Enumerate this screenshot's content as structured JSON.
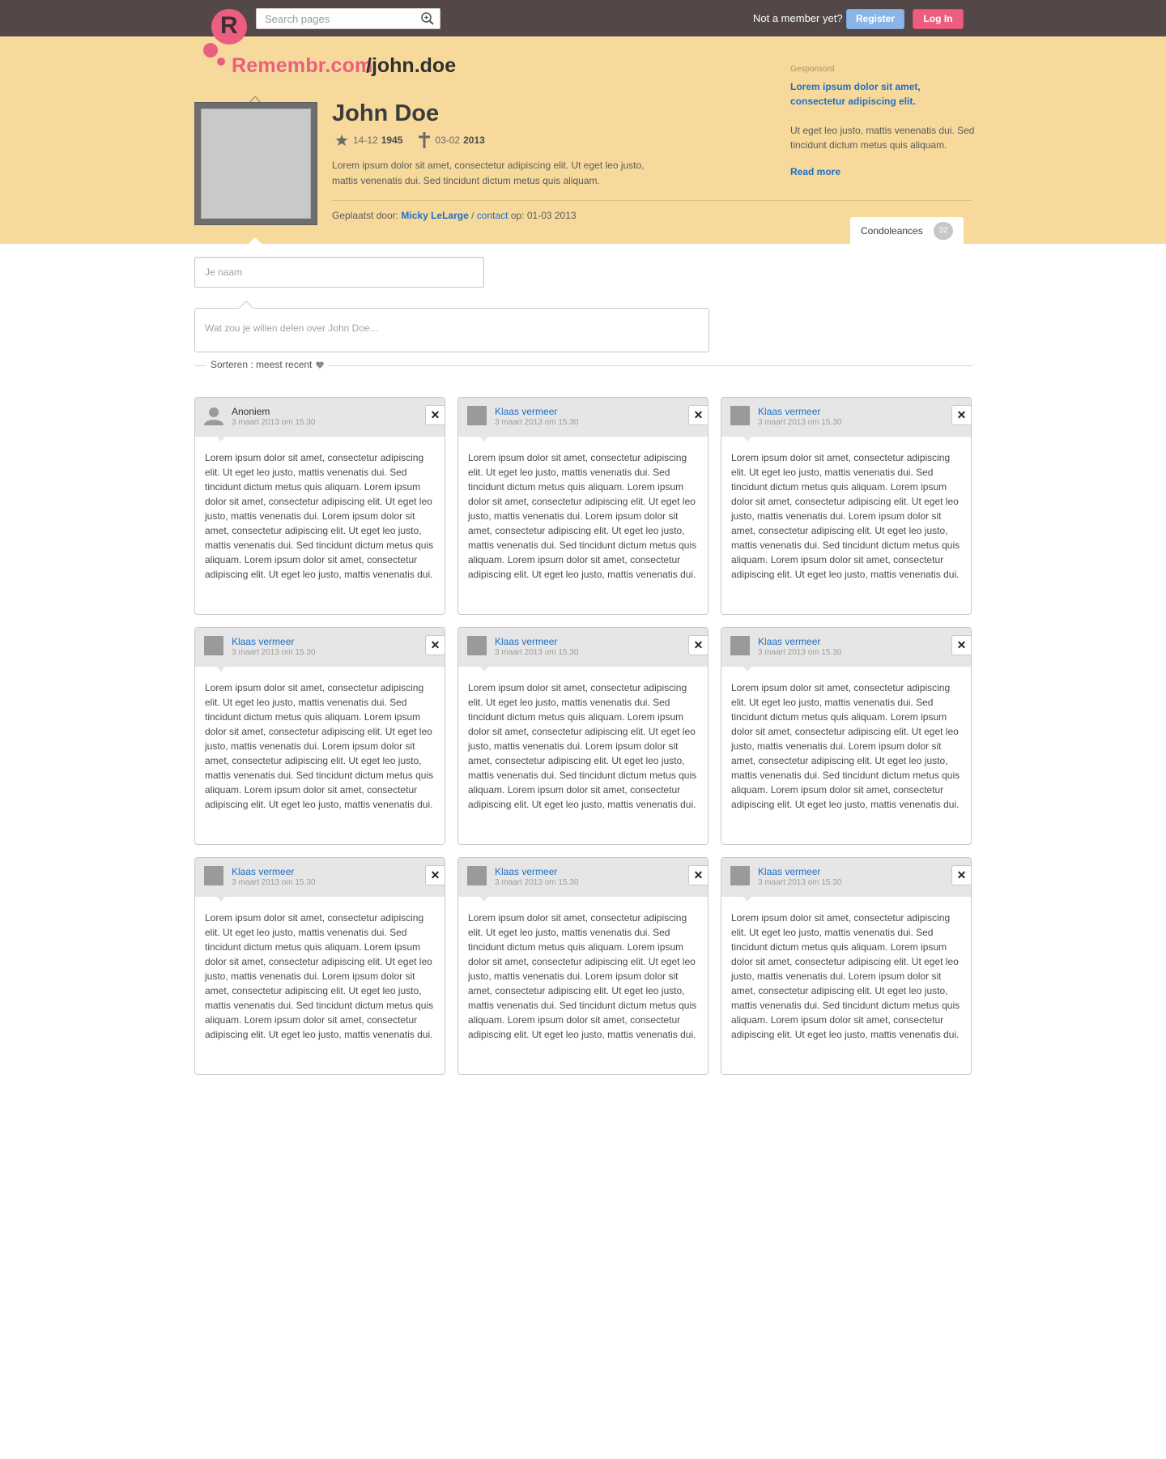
{
  "topbar": {
    "search_placeholder": "Search pages",
    "member_prompt": "Not a member yet?",
    "register_label": "Register",
    "login_label": "Log In",
    "colors": {
      "bar": "#534847",
      "register": "#8bb5e6",
      "login": "#ec5e7f"
    }
  },
  "logo": {
    "letter": "R",
    "brand": "Remembr.com",
    "slug": "/john.doe"
  },
  "profile": {
    "name": "John Doe",
    "birth_daymonth": "14-12",
    "birth_year": "1945",
    "death_daymonth": "03-02",
    "death_year": "2013",
    "bio": "Lorem ipsum dolor sit amet, consectetur adipiscing elit. Ut eget leo justo, mattis venenatis dui. Sed tincidunt dictum metus quis aliquam.",
    "placed_by_label": "Geplaatst door:",
    "placed_by_name": "Micky LeLarge",
    "separator": " / ",
    "contact_label": "contact",
    "placed_on": " op: 01-03 2013"
  },
  "sponsor": {
    "label": "Gesponsord",
    "title": "Lorem ipsum dolor sit amet, consectetur adipiscing elit.",
    "text": "Ut eget leo justo, mattis venenatis dui. Sed tincidunt dictum metus quis aliquam.",
    "more": "Read more"
  },
  "tabs": {
    "condolences_label": "Condoleances",
    "condolences_count": "32"
  },
  "form": {
    "name_placeholder": "Je naam",
    "message_placeholder": "Wat zou je willen delen over John Doe...",
    "sort_label": "Sorteren : meest recent"
  },
  "comments": [
    {
      "author": "Anoniem",
      "time": "3 maart 2013 om 15.30",
      "text": "Lorem ipsum dolor sit amet, consectetur adipiscing elit. Ut eget leo justo, mattis venenatis dui. Sed tincidunt dictum metus quis aliquam. Lorem ipsum dolor sit amet, consectetur adipiscing elit. Ut eget leo justo, mattis venenatis dui. Lorem ipsum dolor sit amet, consectetur adipiscing elit. Ut eget leo justo, mattis venenatis dui. Sed tincidunt dictum metus quis aliquam. Lorem ipsum dolor sit amet, consectetur adipiscing elit. Ut eget leo justo, mattis venenatis dui."
    },
    {
      "author": "Klaas vermeer",
      "time": "3 maart 2013 om 15.30",
      "text": "Lorem ipsum dolor sit amet, consectetur adipiscing elit. Ut eget leo justo, mattis venenatis dui. Sed tincidunt dictum metus quis aliquam. Lorem ipsum dolor sit amet, consectetur adipiscing elit. Ut eget leo justo, mattis venenatis dui. Lorem ipsum dolor sit amet, consectetur adipiscing elit. Ut eget leo justo, mattis venenatis dui. Sed tincidunt dictum metus quis aliquam. Lorem ipsum dolor sit amet, consectetur adipiscing elit. Ut eget leo justo, mattis venenatis dui."
    },
    {
      "author": "Klaas vermeer",
      "time": "3 maart 2013 om 15.30",
      "text": "Lorem ipsum dolor sit amet, consectetur adipiscing elit. Ut eget leo justo, mattis venenatis dui. Sed tincidunt dictum metus quis aliquam. Lorem ipsum dolor sit amet, consectetur adipiscing elit. Ut eget leo justo, mattis venenatis dui. Lorem ipsum dolor sit amet, consectetur adipiscing elit. Ut eget leo justo, mattis venenatis dui. Sed tincidunt dictum metus quis aliquam. Lorem ipsum dolor sit amet, consectetur adipiscing elit. Ut eget leo justo, mattis venenatis dui."
    },
    {
      "author": "Klaas vermeer",
      "time": "3 maart 2013 om 15.30",
      "text": "Lorem ipsum dolor sit amet, consectetur adipiscing elit. Ut eget leo justo, mattis venenatis dui. Sed tincidunt dictum metus quis aliquam. Lorem ipsum dolor sit amet, consectetur adipiscing elit. Ut eget leo justo, mattis venenatis dui. Lorem ipsum dolor sit amet, consectetur adipiscing elit. Ut eget leo justo, mattis venenatis dui. Sed tincidunt dictum metus quis aliquam. Lorem ipsum dolor sit amet, consectetur adipiscing elit. Ut eget leo justo, mattis venenatis dui."
    },
    {
      "author": "Klaas vermeer",
      "time": "3 maart 2013 om 15.30",
      "text": "Lorem ipsum dolor sit amet, consectetur adipiscing elit. Ut eget leo justo, mattis venenatis dui. Sed tincidunt dictum metus quis aliquam. Lorem ipsum dolor sit amet, consectetur adipiscing elit. Ut eget leo justo, mattis venenatis dui. Lorem ipsum dolor sit amet, consectetur adipiscing elit. Ut eget leo justo, mattis venenatis dui. Sed tincidunt dictum metus quis aliquam. Lorem ipsum dolor sit amet, consectetur adipiscing elit. Ut eget leo justo, mattis venenatis dui."
    },
    {
      "author": "Klaas vermeer",
      "time": "3 maart 2013 om 15.30",
      "text": "Lorem ipsum dolor sit amet, consectetur adipiscing elit. Ut eget leo justo, mattis venenatis dui. Sed tincidunt dictum metus quis aliquam. Lorem ipsum dolor sit amet, consectetur adipiscing elit. Ut eget leo justo, mattis venenatis dui. Lorem ipsum dolor sit amet, consectetur adipiscing elit. Ut eget leo justo, mattis venenatis dui. Sed tincidunt dictum metus quis aliquam. Lorem ipsum dolor sit amet, consectetur adipiscing elit. Ut eget leo justo, mattis venenatis dui."
    },
    {
      "author": "Klaas vermeer",
      "time": "3 maart 2013 om 15.30",
      "text": "Lorem ipsum dolor sit amet, consectetur adipiscing elit. Ut eget leo justo, mattis venenatis dui. Sed tincidunt dictum metus quis aliquam. Lorem ipsum dolor sit amet, consectetur adipiscing elit. Ut eget leo justo, mattis venenatis dui. Lorem ipsum dolor sit amet, consectetur adipiscing elit. Ut eget leo justo, mattis venenatis dui. Sed tincidunt dictum metus quis aliquam. Lorem ipsum dolor sit amet, consectetur adipiscing elit. Ut eget leo justo, mattis venenatis dui."
    },
    {
      "author": "Klaas vermeer",
      "time": "3 maart 2013 om 15.30",
      "text": "Lorem ipsum dolor sit amet, consectetur adipiscing elit. Ut eget leo justo, mattis venenatis dui. Sed tincidunt dictum metus quis aliquam. Lorem ipsum dolor sit amet, consectetur adipiscing elit. Ut eget leo justo, mattis venenatis dui. Lorem ipsum dolor sit amet, consectetur adipiscing elit. Ut eget leo justo, mattis venenatis dui. Sed tincidunt dictum metus quis aliquam. Lorem ipsum dolor sit amet, consectetur adipiscing elit. Ut eget leo justo, mattis venenatis dui."
    },
    {
      "author": "Klaas vermeer",
      "time": "3 maart 2013 om 15.30",
      "text": "Lorem ipsum dolor sit amet, consectetur adipiscing elit. Ut eget leo justo, mattis venenatis dui. Sed tincidunt dictum metus quis aliquam. Lorem ipsum dolor sit amet, consectetur adipiscing elit. Ut eget leo justo, mattis venenatis dui. Lorem ipsum dolor sit amet, consectetur adipiscing elit. Ut eget leo justo, mattis venenatis dui. Sed tincidunt dictum metus quis aliquam. Lorem ipsum dolor sit amet, consectetur adipiscing elit. Ut eget leo justo, mattis venenatis dui."
    }
  ],
  "icons": {
    "close": "close-icon",
    "search": "search-icon",
    "birth": "star-icon",
    "death": "cross-icon",
    "sort": "heart-icon"
  },
  "colors": {
    "header": "#f7d99c",
    "link": "#1f6fc4",
    "brand": "#ec5e7f"
  }
}
